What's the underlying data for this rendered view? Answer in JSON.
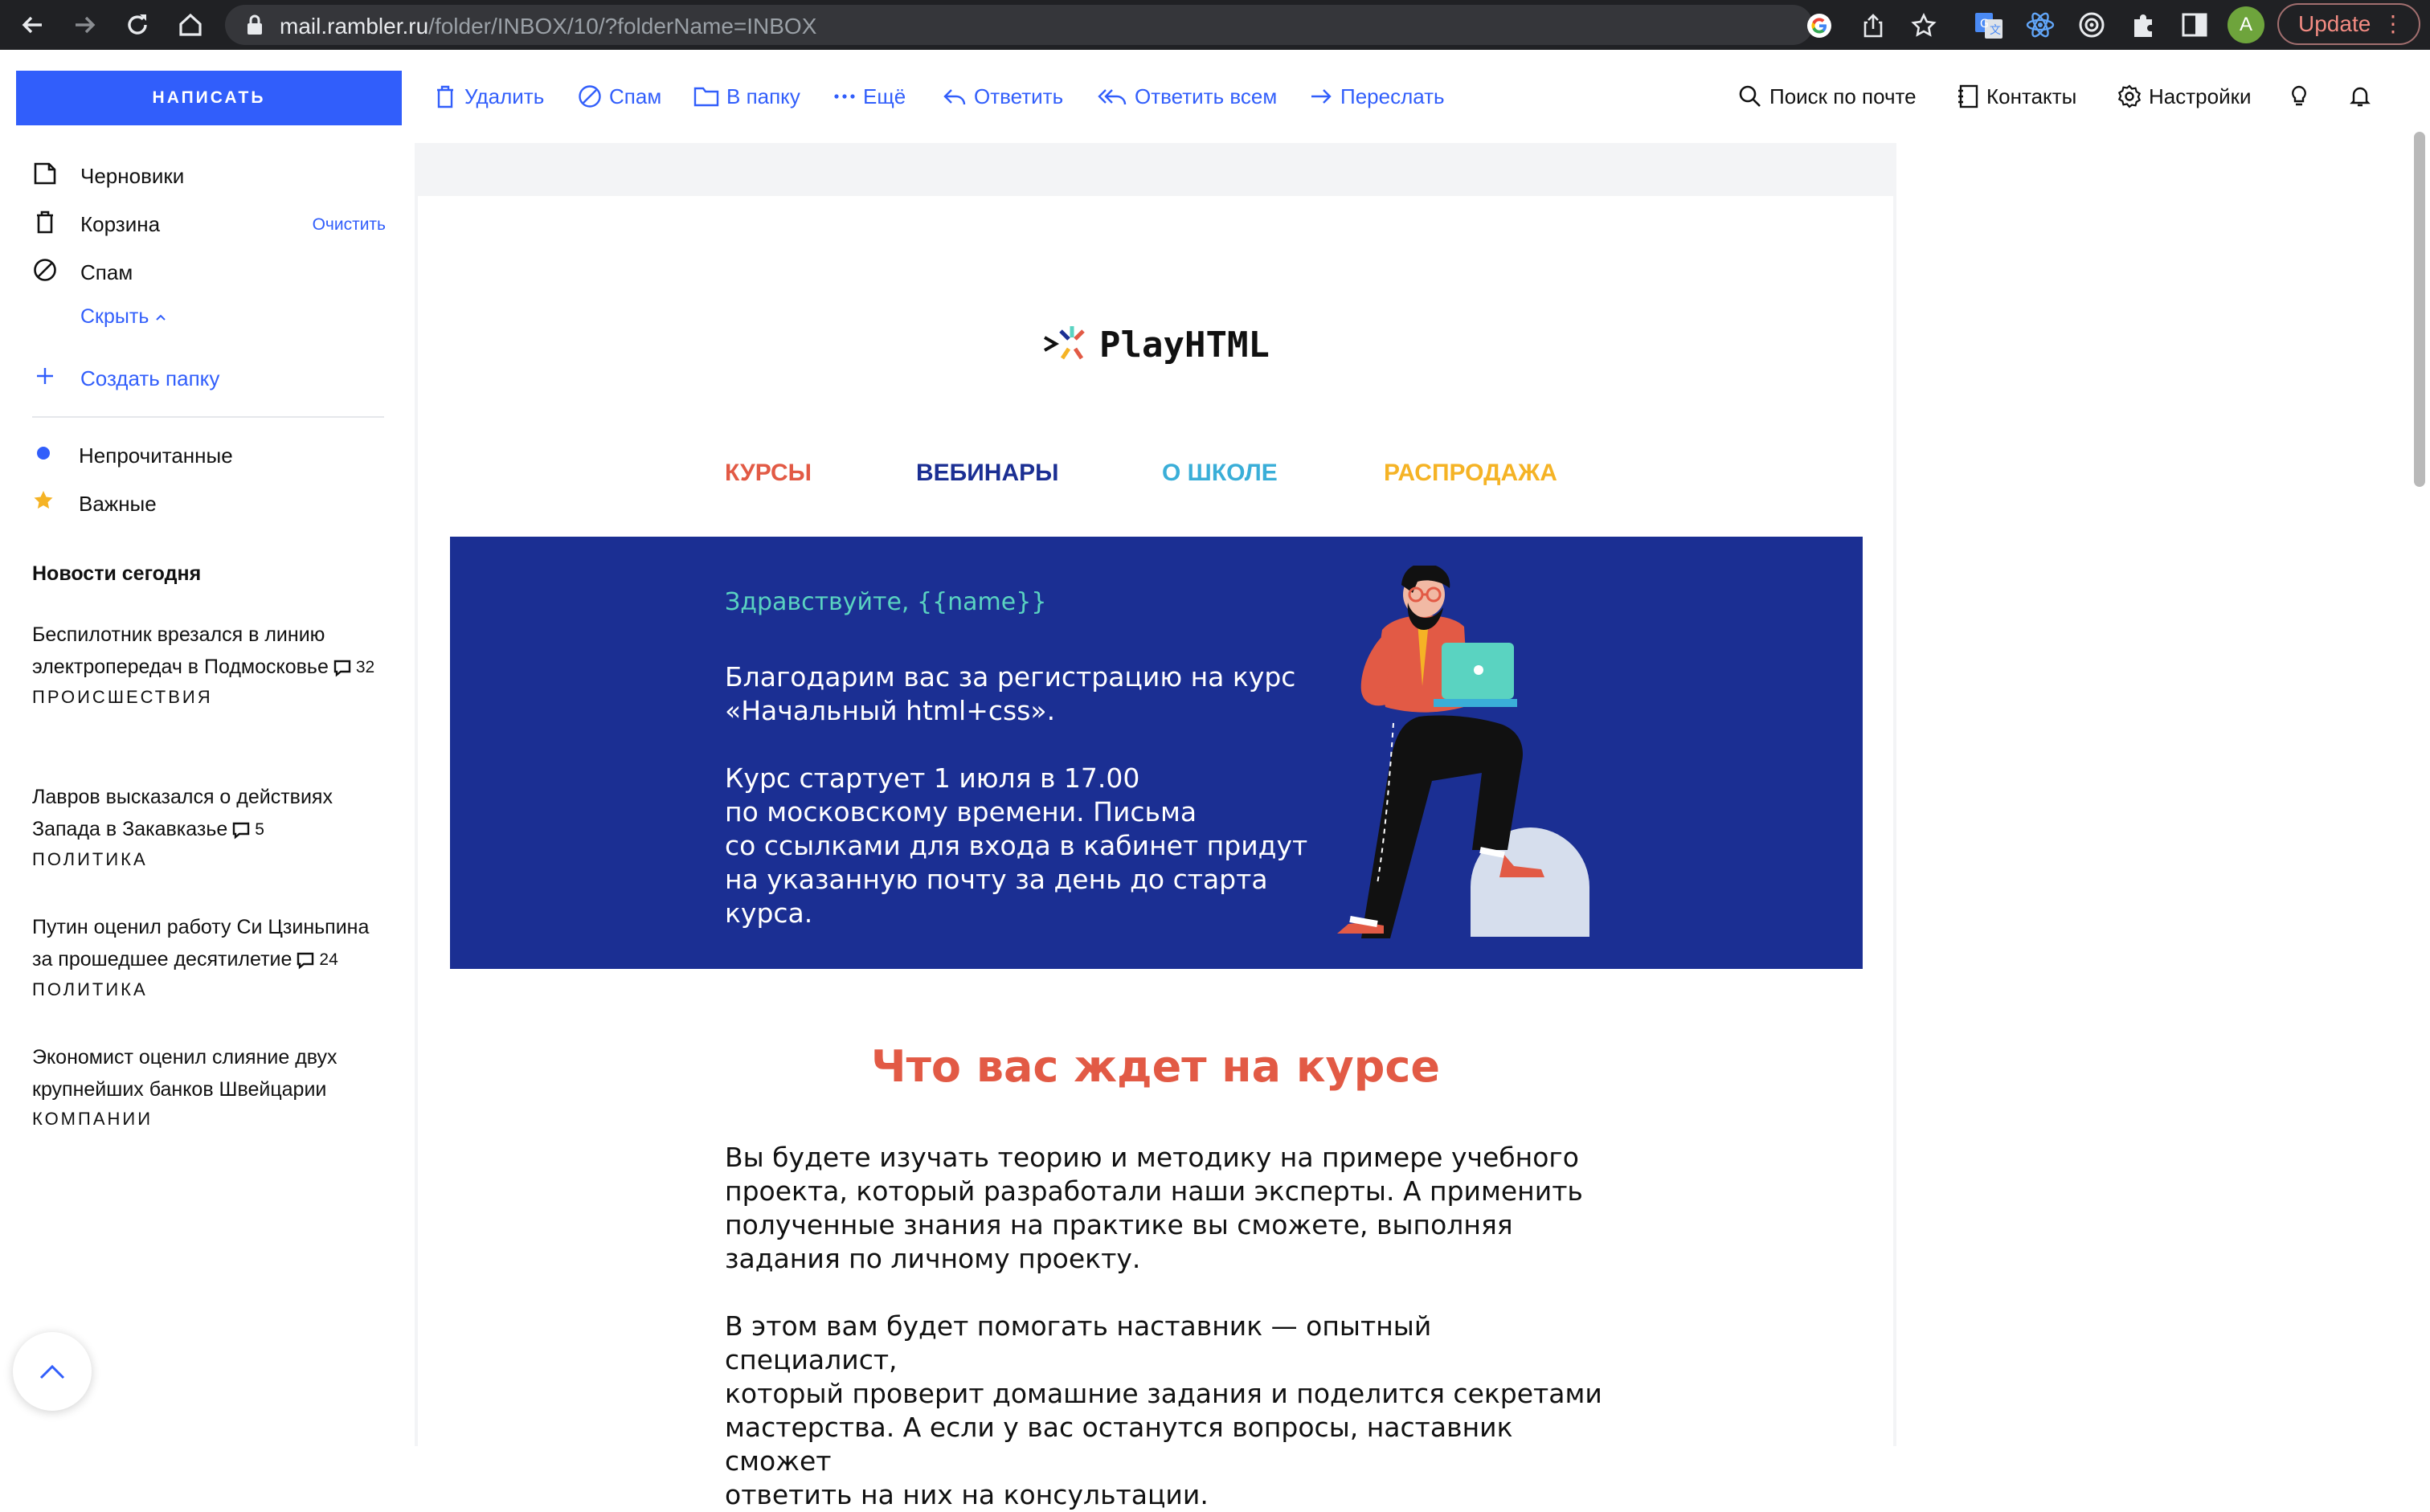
{
  "browser": {
    "url_host": "mail.rambler.ru",
    "url_path": "/folder/INBOX/10/?folderName=INBOX",
    "avatar_letter": "A",
    "update_label": "Update"
  },
  "sidebar": {
    "compose_label": "НАПИСАТЬ",
    "folders": [
      {
        "label": "Черновики",
        "icon": "drafts-icon"
      },
      {
        "label": "Корзина",
        "icon": "trash-icon",
        "action": "Очистить"
      },
      {
        "label": "Спам",
        "icon": "spam-icon"
      }
    ],
    "hide_label": "Скрыть",
    "create_folder_label": "Создать папку",
    "filters": [
      {
        "label": "Непрочитанные",
        "color": "#315efb"
      },
      {
        "label": "Важные",
        "color": "#f5b325"
      }
    ],
    "news_title": "Новости сегодня",
    "news": [
      {
        "text": "Беспилотник врезался в линию электропередач в Подмосковье",
        "comments": "32",
        "category": "ПРОИСШЕСТВИЯ"
      },
      {
        "text": "Лавров высказался о действиях Запада в Закавказье",
        "comments": "5",
        "category": "ПОЛИТИКА"
      },
      {
        "text": "Путин оценил работу Си Цзиньпина за прошедшее десятилетие",
        "comments": "24",
        "category": "ПОЛИТИКА"
      },
      {
        "text": "Экономист оценил слияние двух крупнейших банков Швейцарии",
        "comments": "",
        "category": "КОМПАНИИ"
      }
    ]
  },
  "toolbar": {
    "delete": "Удалить",
    "spam": "Спам",
    "to_folder": "В папку",
    "more": "Ещё",
    "reply": "Ответить",
    "reply_all": "Ответить всем",
    "forward": "Переслать",
    "search": "Поиск по почте",
    "contacts": "Контакты",
    "settings": "Настройки"
  },
  "email": {
    "logo_text": "PlayHTML",
    "nav": [
      {
        "label": "КУРСЫ",
        "color": "#e25a45"
      },
      {
        "label": "ВЕБИНАРЫ",
        "color": "#1b2f93"
      },
      {
        "label": "О ШКОЛЕ",
        "color": "#3aaed8"
      },
      {
        "label": "РАСПРОДАЖА",
        "color": "#f5b325"
      }
    ],
    "greeting": "Здравствуйте, {{name}}",
    "banner_lines_1": [
      "Благодарим вас за регистрацию на курс",
      "«Начальный html+css»."
    ],
    "banner_lines_2": [
      "Курс стартует 1 июля в 17.00",
      "по московскому времени. Письма",
      "со ссылками для входа в кабинет придут",
      "на указанную почту за день до старта",
      "курса."
    ],
    "heading": "Что вас ждет на курсе",
    "para1": [
      "Вы будете изучать теорию и методику на примере учебного",
      "проекта, который разработали наши эксперты. А применить",
      "полученные знания на практике вы сможете, выполняя",
      "задания по личному проекту."
    ],
    "para2": [
      "В этом вам будет помогать наставник — опытный специалист,",
      "который проверит домашние задания и поделится секретами",
      "мастерства. А если у вас останутся вопросы, наставник сможет",
      "ответить на них на консультации."
    ]
  }
}
